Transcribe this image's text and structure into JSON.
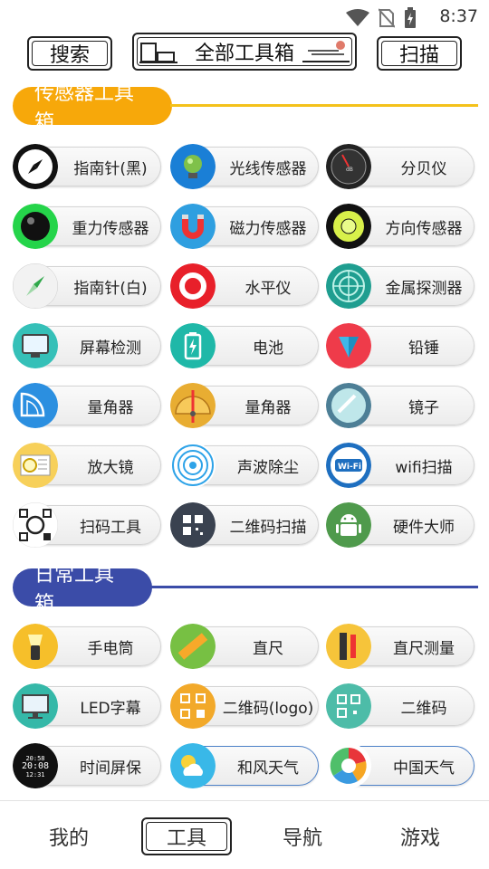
{
  "status": {
    "time": "8:37"
  },
  "topbar": {
    "search_label": "搜索",
    "all_tools_label": "全部工具箱",
    "scan_label": "扫描"
  },
  "sections": [
    {
      "title": "传感器工具箱",
      "color": "#f7a80a"
    },
    {
      "title": "日常工具箱",
      "color": "#3b4ca8"
    }
  ],
  "sensor_tools": [
    {
      "label": "指南针(黑)",
      "icon": "compass-black-icon"
    },
    {
      "label": "光线传感器",
      "icon": "light-sensor-icon"
    },
    {
      "label": "分贝仪",
      "icon": "decibel-meter-icon"
    },
    {
      "label": "重力传感器",
      "icon": "gravity-sensor-icon"
    },
    {
      "label": "磁力传感器",
      "icon": "magnet-icon"
    },
    {
      "label": "方向传感器",
      "icon": "direction-sensor-icon"
    },
    {
      "label": "指南针(白)",
      "icon": "compass-white-icon"
    },
    {
      "label": "水平仪",
      "icon": "level-icon"
    },
    {
      "label": "金属探测器",
      "icon": "metal-detector-icon"
    },
    {
      "label": "屏幕检测",
      "icon": "screen-test-icon"
    },
    {
      "label": "电池",
      "icon": "battery-icon"
    },
    {
      "label": "铅锤",
      "icon": "plumb-bob-icon"
    },
    {
      "label": "量角器",
      "icon": "protractor-icon"
    },
    {
      "label": "量角器",
      "icon": "protractor-2-icon"
    },
    {
      "label": "镜子",
      "icon": "mirror-icon"
    },
    {
      "label": "放大镜",
      "icon": "magnifier-icon"
    },
    {
      "label": "声波除尘",
      "icon": "sound-wave-icon"
    },
    {
      "label": "wifi扫描",
      "icon": "wifi-icon"
    },
    {
      "label": "扫码工具",
      "icon": "scan-code-icon"
    },
    {
      "label": "二维码扫描",
      "icon": "qr-scan-icon"
    },
    {
      "label": "硬件大师",
      "icon": "android-icon"
    }
  ],
  "daily_tools": [
    {
      "label": "手电筒",
      "icon": "flashlight-icon"
    },
    {
      "label": "直尺",
      "icon": "ruler-icon"
    },
    {
      "label": "直尺测量",
      "icon": "ruler-measure-icon"
    },
    {
      "label": "LED字幕",
      "icon": "led-monitor-icon"
    },
    {
      "label": "二维码(logo)",
      "icon": "qr-logo-icon"
    },
    {
      "label": "二维码",
      "icon": "qr-code-icon"
    },
    {
      "label": "时间屏保",
      "icon": "clock-icon",
      "clock": [
        "20:58",
        "20:08",
        "12:31"
      ]
    },
    {
      "label": "和风天气",
      "icon": "weather-icon"
    },
    {
      "label": "中国天气",
      "icon": "china-weather-icon"
    }
  ],
  "bottom_nav": [
    {
      "label": "我的",
      "active": false
    },
    {
      "label": "工具",
      "active": true
    },
    {
      "label": "导航",
      "active": false
    },
    {
      "label": "游戏",
      "active": false
    }
  ]
}
